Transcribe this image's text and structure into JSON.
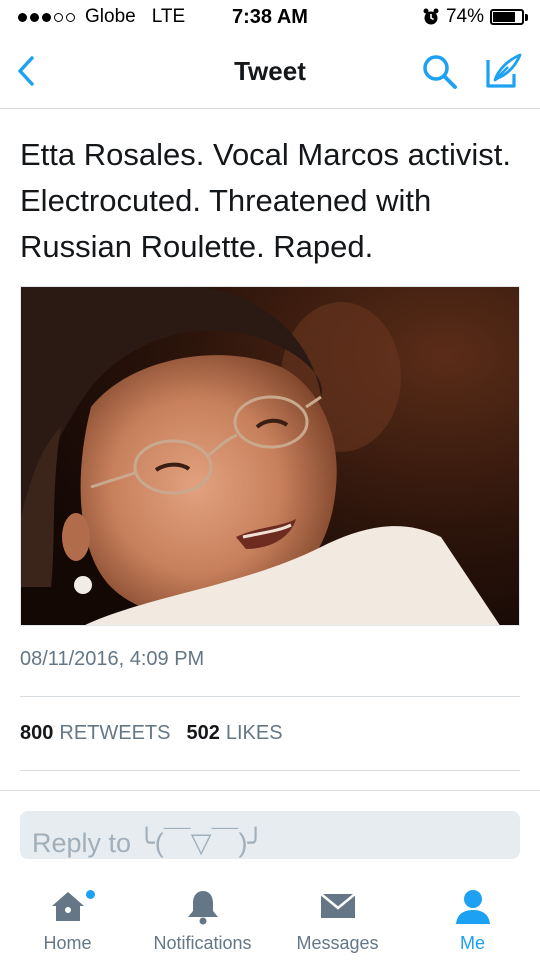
{
  "status_bar": {
    "carrier": "Globe",
    "network": "LTE",
    "time": "7:38 AM",
    "battery": "74%",
    "battery_level": 0.74,
    "signal_bars_filled": 3,
    "signal_bars_total": 5
  },
  "nav": {
    "title": "Tweet",
    "icons": [
      "chevron-left-icon",
      "search-icon",
      "compose-icon"
    ]
  },
  "tweet": {
    "text": "Etta Rosales. Vocal Marcos activist. Electrocuted. Threatened with Russian Roulette. Raped.",
    "timestamp": "08/11/2016, 4:09 PM",
    "retweets_count": "800",
    "retweets_label": "RETWEETS",
    "likes_count": "502",
    "likes_label": "LIKES"
  },
  "reply": {
    "placeholder": "Reply to ╰(￣▽￣)╯"
  },
  "tabbar": {
    "items": [
      {
        "label": "Home",
        "icon": "home-icon"
      },
      {
        "label": "Notifications",
        "icon": "bell-icon"
      },
      {
        "label": "Messages",
        "icon": "envelope-icon"
      },
      {
        "label": "Me",
        "icon": "person-icon"
      }
    ],
    "active": "Me"
  },
  "colors": {
    "accent": "#1da1f2",
    "muted": "#657786",
    "icon": "#657786"
  }
}
